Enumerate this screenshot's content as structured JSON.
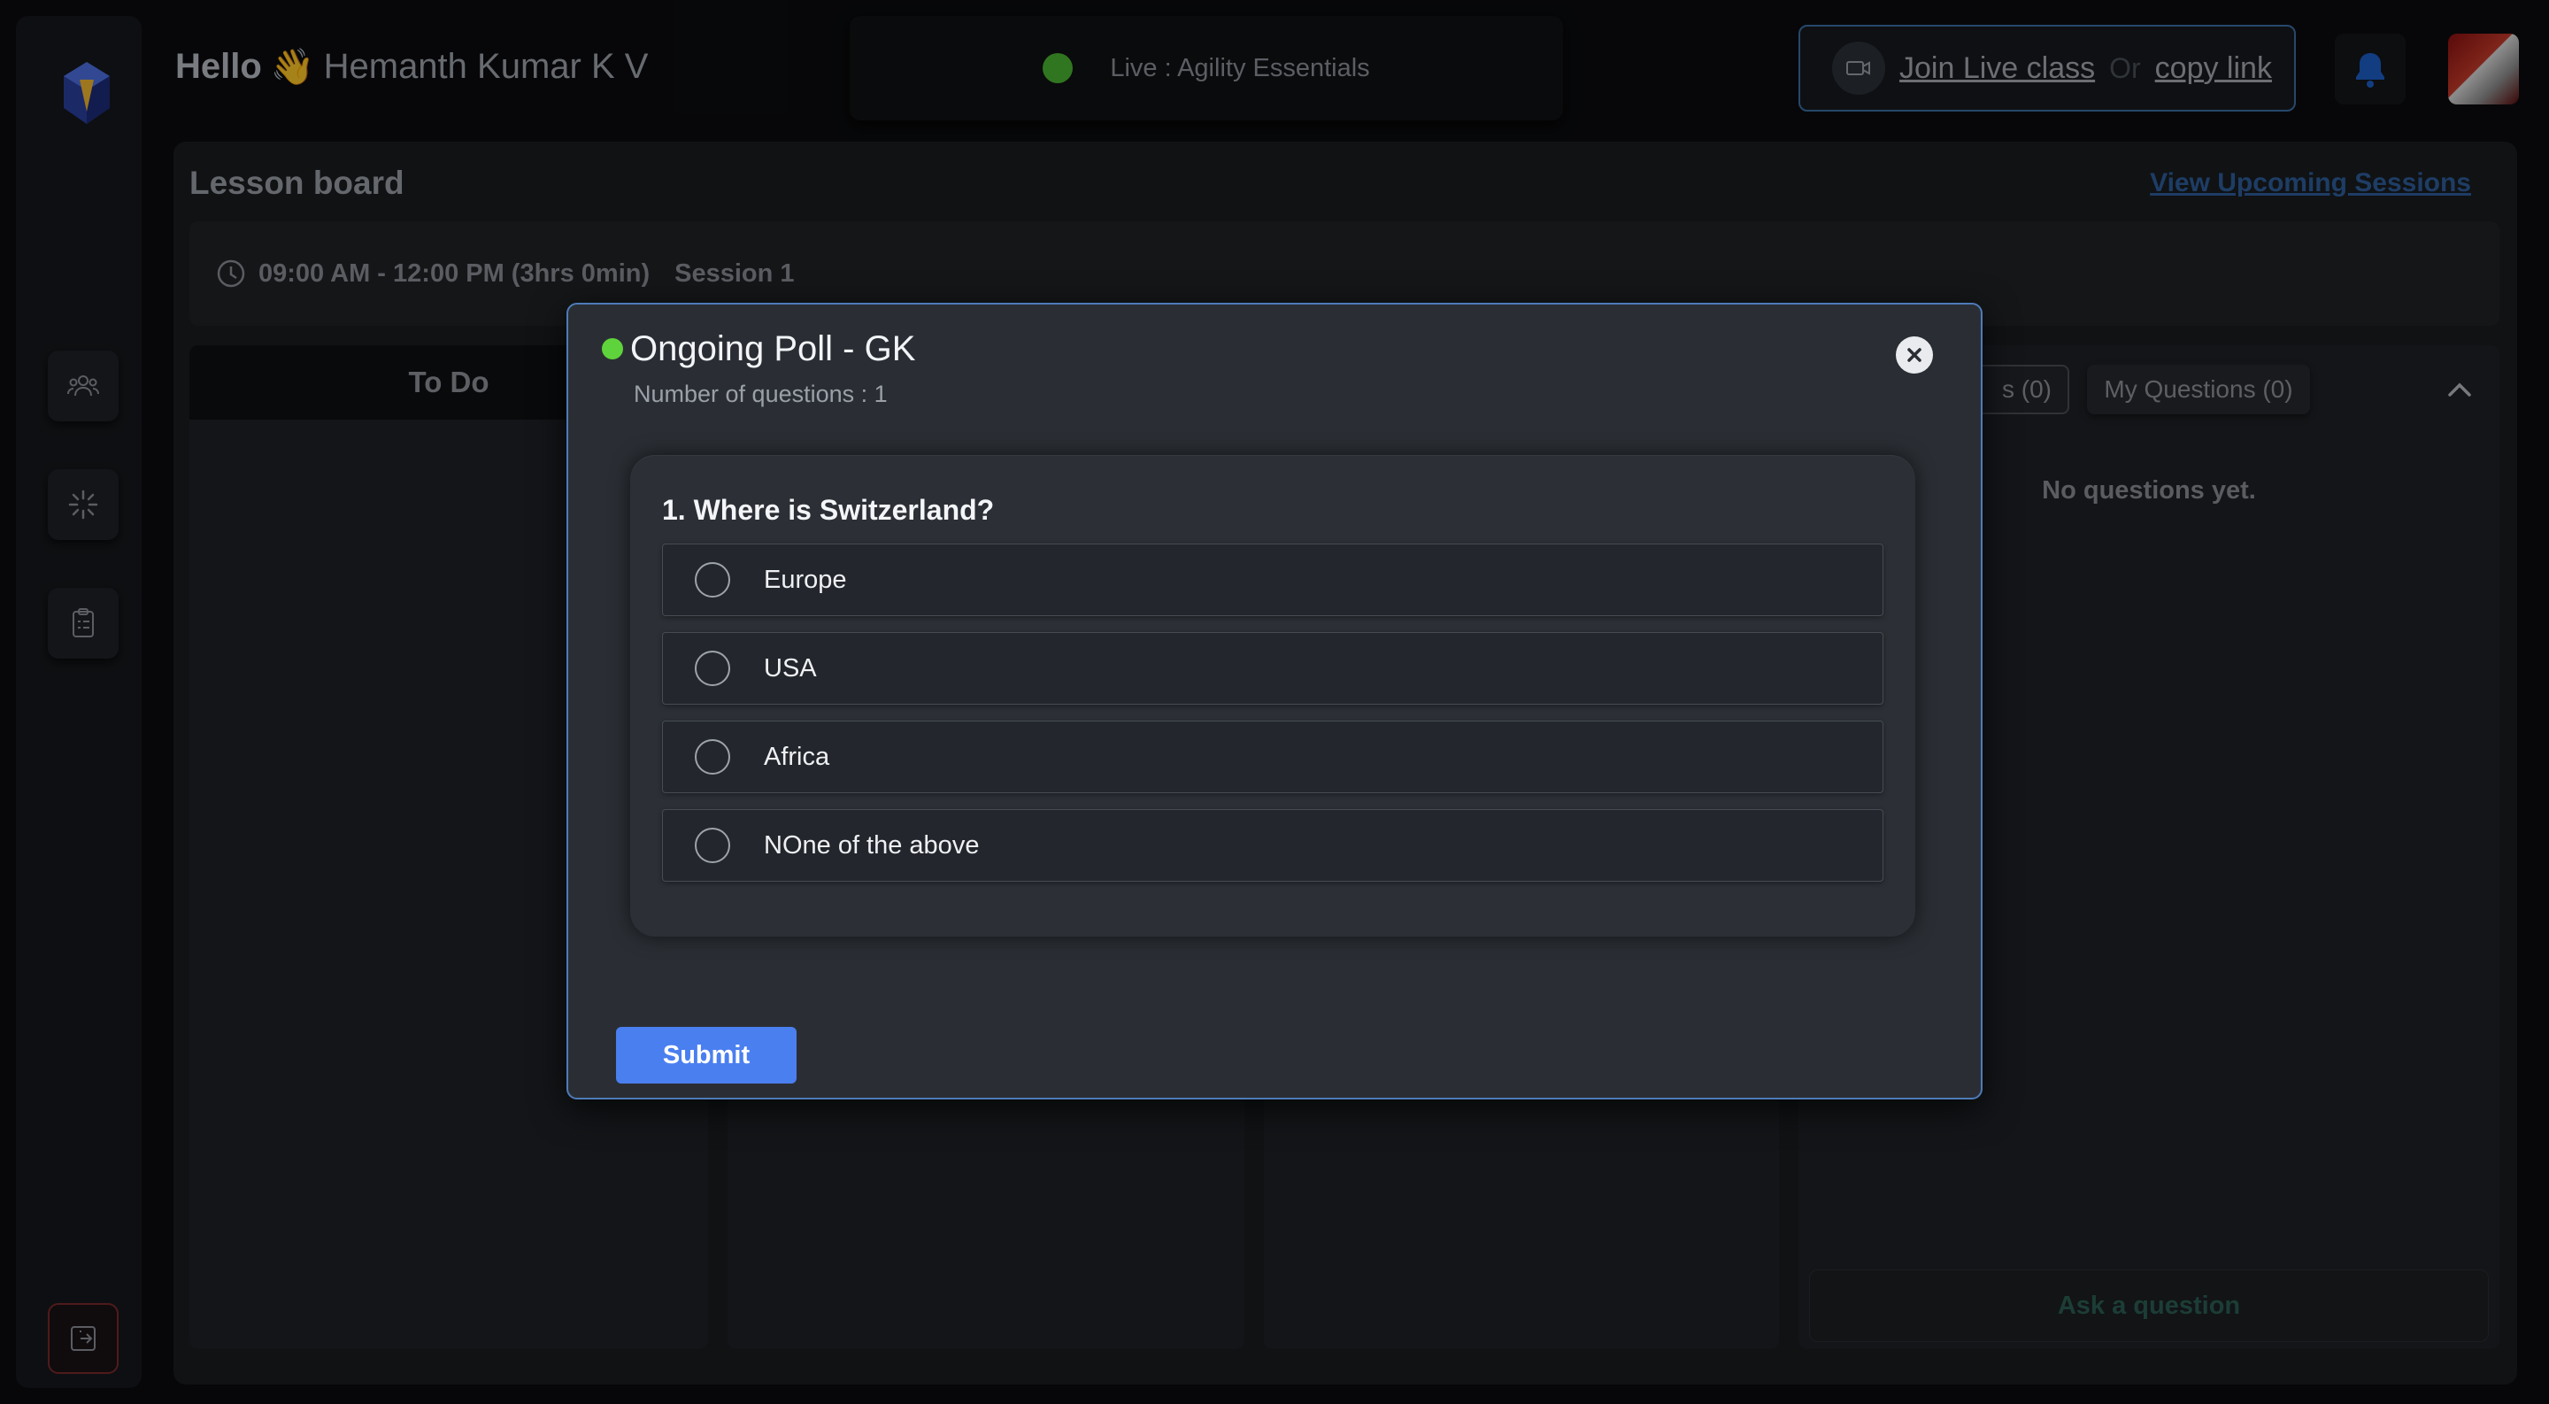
{
  "header": {
    "greeting": "Hello",
    "wave_emoji": "👋",
    "user_name": "Hemanth Kumar K V",
    "live_text": "Live : Agility Essentials",
    "join_label": "Join Live class",
    "or_text": "Or",
    "copy_label": "copy link"
  },
  "lesson": {
    "title": "Lesson board",
    "upcoming_link": "View Upcoming Sessions",
    "time_range": "09:00 AM - 12:00 PM (3hrs 0min)",
    "session_label": "Session 1",
    "columns": [
      "To Do"
    ]
  },
  "qa": {
    "tab_all": "s (0)",
    "tab_mine": "My Questions (0)",
    "empty_text": "No questions yet.",
    "ask_button": "Ask a question"
  },
  "poll": {
    "title": "Ongoing Poll - GK",
    "subtitle": "Number of questions : 1",
    "question": "1. Where is Switzerland?",
    "options": [
      "Europe",
      "USA",
      "Africa",
      "NOne of the above"
    ],
    "submit_label": "Submit"
  },
  "icons": {
    "logo": "app-logo-icon",
    "sidebar": [
      "users-icon",
      "sparkle-icon",
      "clipboard-icon"
    ],
    "logout": "logout-icon",
    "bell": "bell-icon",
    "video": "video-camera-icon",
    "clock": "clock-icon",
    "close": "close-icon",
    "chevron": "chevron-up-icon"
  },
  "colors": {
    "live_dot": "#4bb532",
    "poll_dot": "#5fd33b",
    "accent": "#4a7ff0",
    "link": "#2f5f9b"
  }
}
